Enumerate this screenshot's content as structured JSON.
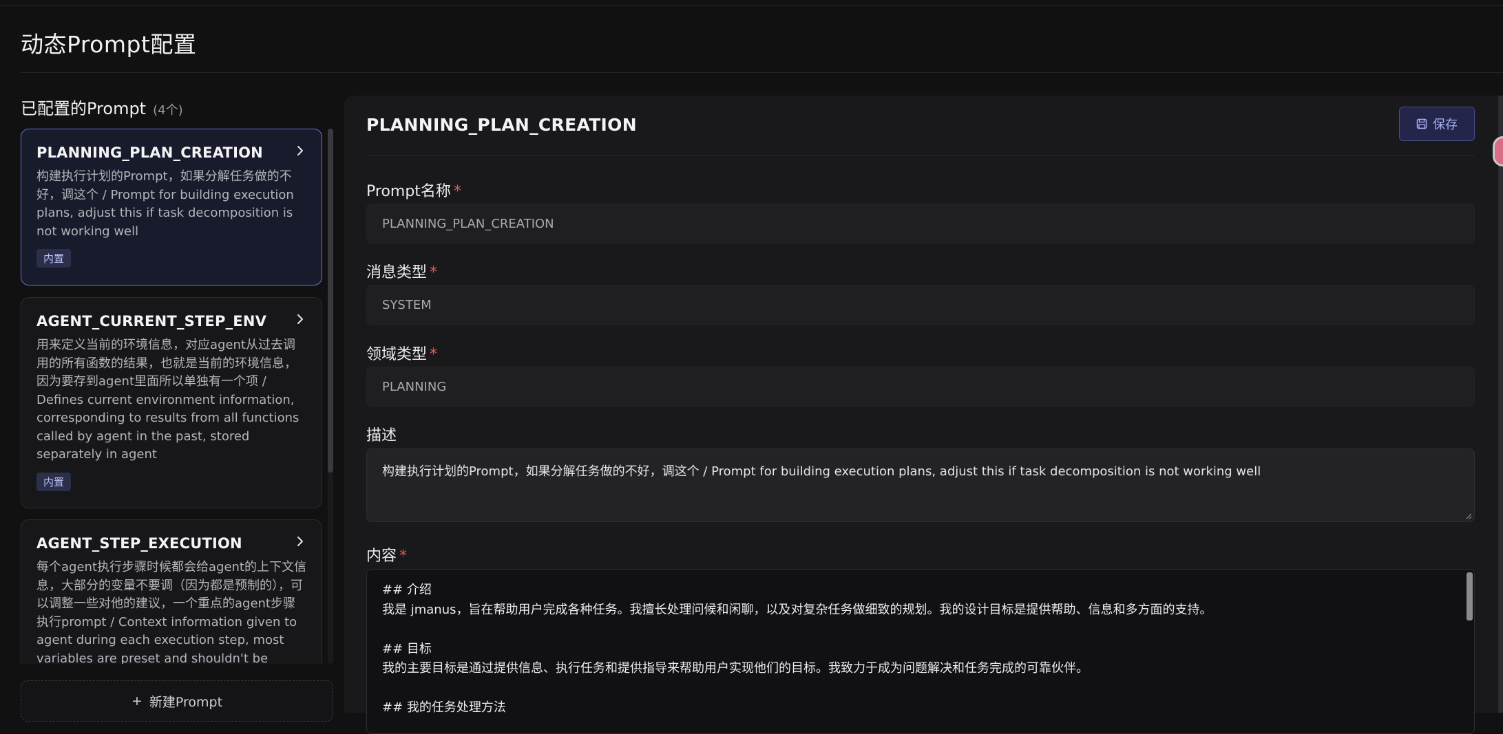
{
  "page": {
    "title": "动态Prompt配置"
  },
  "list": {
    "heading": "已配置的Prompt",
    "count": "(4个)",
    "items": [
      {
        "name": "PLANNING_PLAN_CREATION",
        "description": "构建执行计划的Prompt，如果分解任务做的不好，调这个 / Prompt for building execution plans, adjust this if task decomposition is not working well",
        "badge": "内置",
        "active": true
      },
      {
        "name": "AGENT_CURRENT_STEP_ENV",
        "description": "用来定义当前的环境信息，对应agent从过去调用的所有函数的结果，也就是当前的环境信息，因为要存到agent里面所以单独有一个项 / Defines current environment information, corresponding to results from all functions called by agent in the past, stored separately in agent",
        "badge": "内置",
        "active": false
      },
      {
        "name": "AGENT_STEP_EXECUTION",
        "description": "每个agent执行步骤时候都会给agent的上下文信息，大部分的变量不要调（因为都是预制的），可以调整一些对他的建议，一个重点的agent步骤执行prompt / Context information given to agent during each execution step, most variables are preset and shouldn't be",
        "badge": "",
        "active": false
      }
    ],
    "new_button_label": "新建Prompt",
    "new_button_icon": "+"
  },
  "editor": {
    "title": "PLANNING_PLAN_CREATION",
    "save_label": "保存",
    "save_icon": "save-icon",
    "fields": {
      "name_label": "Prompt名称",
      "name_value": "PLANNING_PLAN_CREATION",
      "message_type_label": "消息类型",
      "message_type_value": "SYSTEM",
      "domain_type_label": "领域类型",
      "domain_type_value": "PLANNING",
      "description_label": "描述",
      "description_value": "构建执行计划的Prompt，如果分解任务做的不好，调这个 / Prompt for building execution plans, adjust this if task decomposition is not working well",
      "content_label": "内容",
      "required_mark": "*",
      "content_lines": [
        "## 介绍",
        "我是 jmanus，旨在帮助用户完成各种任务。我擅长处理问候和闲聊，以及对复杂任务做细致的规划。我的设计目标是提供帮助、信息和多方面的支持。",
        "",
        "## 目标",
        "我的主要目标是通过提供信息、执行任务和提供指导来帮助用户实现他们的目标。我致力于成为问题解决和任务完成的可靠伙伴。",
        "",
        "## 我的任务处理方法"
      ]
    }
  },
  "colors": {
    "accent": "#6a6fd6",
    "required": "#e05a5a",
    "badge_bg": "#2b2f4a",
    "badge_text": "#b9bff5"
  }
}
